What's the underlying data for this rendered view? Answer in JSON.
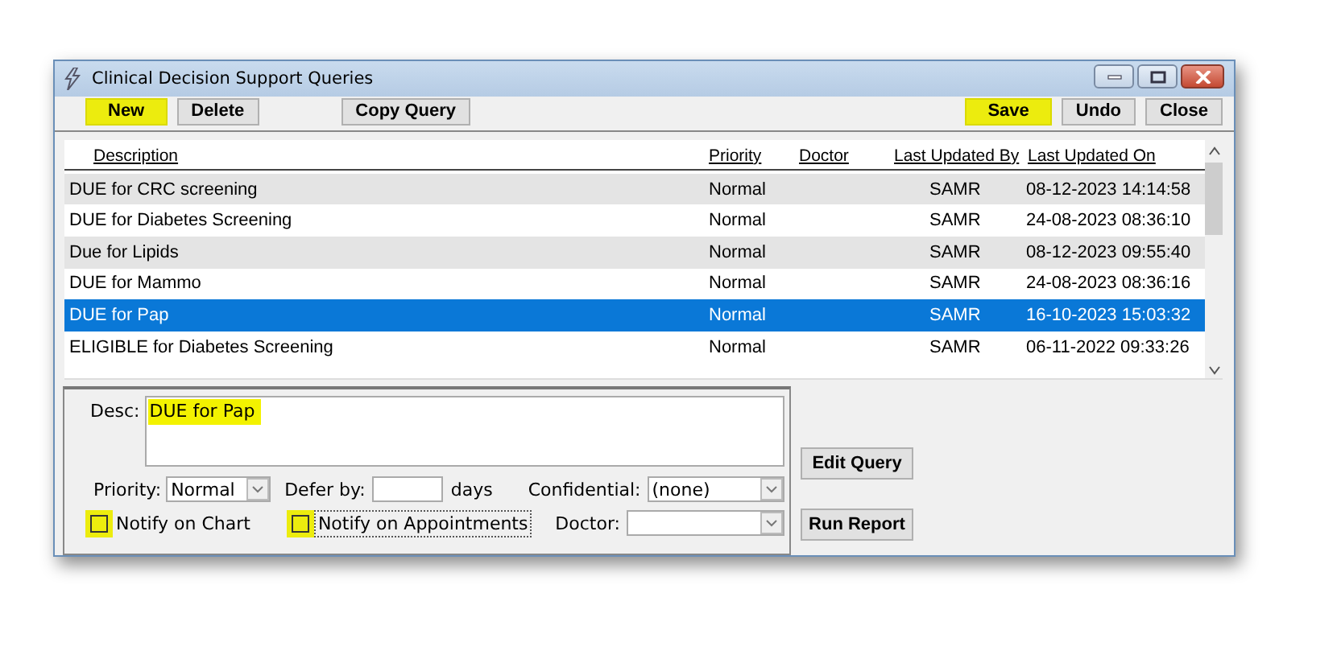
{
  "window": {
    "title": "Clinical Decision Support Queries"
  },
  "toolbar": {
    "left": [
      {
        "label": "New",
        "highlighted": true
      },
      {
        "label": "Delete",
        "highlighted": false
      },
      {
        "label": "Copy Query",
        "highlighted": false
      }
    ],
    "right": [
      {
        "label": "Save",
        "highlighted": true
      },
      {
        "label": "Undo",
        "highlighted": false
      },
      {
        "label": "Close",
        "highlighted": false
      }
    ]
  },
  "table": {
    "columns": [
      "Description",
      "Priority",
      "Doctor",
      "Last Updated By",
      "Last Updated On"
    ],
    "rows": [
      {
        "cells": [
          "DUE for CRC screening",
          "Normal",
          "",
          "SAMR",
          "08-12-2023 14:14:58"
        ],
        "selected": false
      },
      {
        "cells": [
          "DUE for Diabetes Screening",
          "Normal",
          "",
          "SAMR",
          "24-08-2023 08:36:10"
        ],
        "selected": false
      },
      {
        "cells": [
          "Due for Lipids",
          "Normal",
          "",
          "SAMR",
          "08-12-2023 09:55:40"
        ],
        "selected": false
      },
      {
        "cells": [
          "DUE for Mammo",
          "Normal",
          "",
          "SAMR",
          "24-08-2023 08:36:16"
        ],
        "selected": false
      },
      {
        "cells": [
          "DUE for Pap",
          "Normal",
          "",
          "SAMR",
          "16-10-2023 15:03:32"
        ],
        "selected": true
      },
      {
        "cells": [
          "ELIGIBLE for Diabetes Screening",
          "Normal",
          "",
          "SAMR",
          "06-11-2022 09:33:26"
        ],
        "selected": false
      }
    ]
  },
  "form": {
    "desc": {
      "label": "Desc:",
      "value": "DUE for Pap",
      "highlighted": true
    },
    "priority": {
      "label": "Priority:",
      "value": "Normal"
    },
    "defer": {
      "label": "Defer by:",
      "unit": "days"
    },
    "confidential": {
      "label": "Confidential:",
      "value": "(none)"
    },
    "doctor": {
      "label": "Doctor:"
    },
    "checkboxes": [
      {
        "label": "Notify on Chart",
        "checked": false,
        "highlighted": true,
        "focused": false
      },
      {
        "label": "Notify on Appointments",
        "checked": false,
        "highlighted": true,
        "focused": true
      }
    ]
  },
  "side_buttons": [
    "Edit Query",
    "Run Report"
  ]
}
